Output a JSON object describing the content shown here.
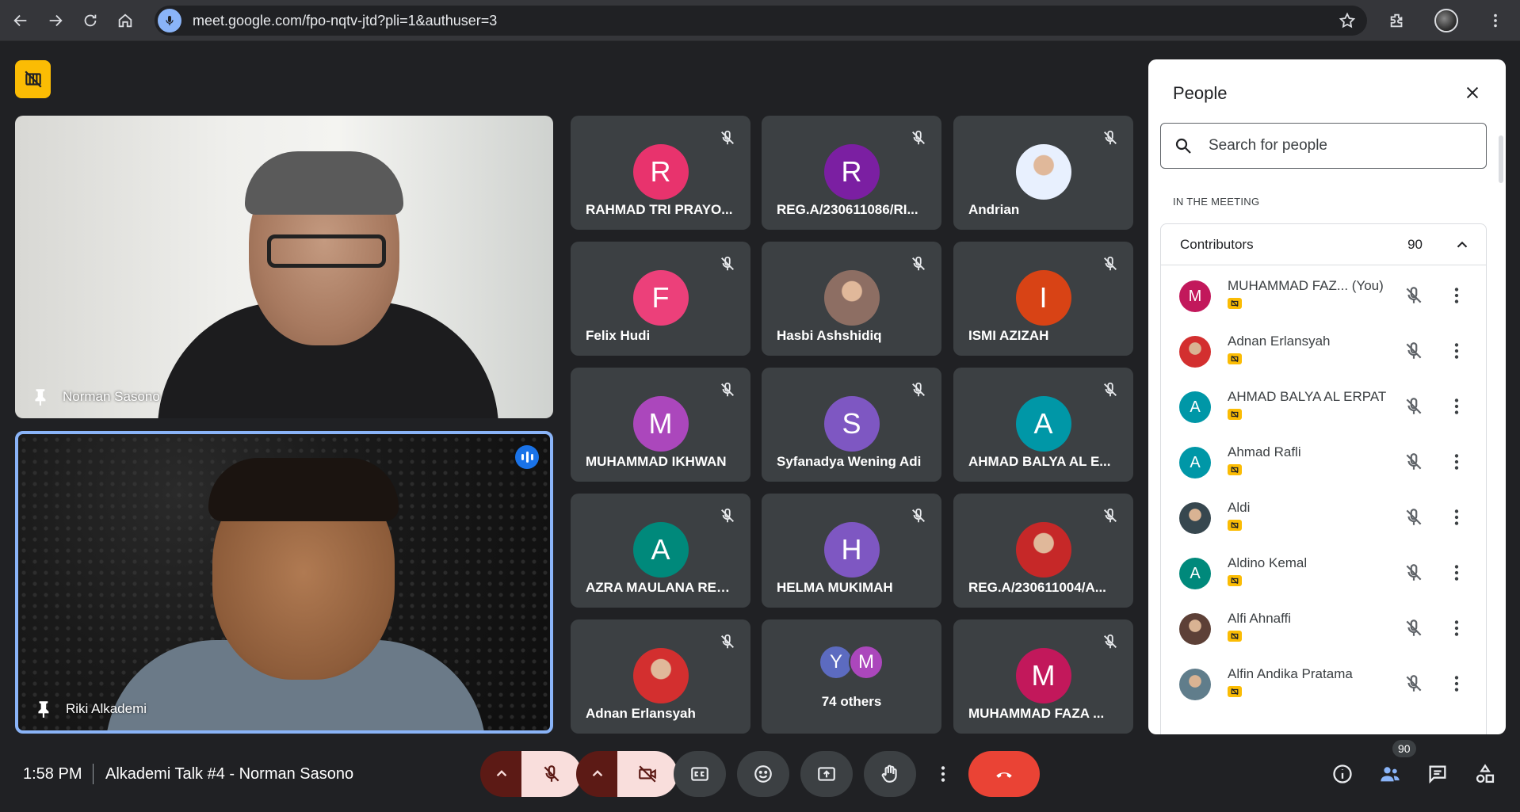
{
  "browser": {
    "url": "meet.google.com/fpo-nqtv-jtd?pli=1&authuser=3"
  },
  "videos": [
    {
      "name": "Norman Sasono"
    },
    {
      "name": "Riki Alkademi"
    }
  ],
  "grid": [
    {
      "name": "RAHMAD TRI PRAYO...",
      "initial": "R",
      "color": "#e8336d"
    },
    {
      "name": "REG.A/230611086/RI...",
      "initial": "R",
      "color": "#7b1fa2"
    },
    {
      "name": "Andrian",
      "initial": "",
      "color": "#e8f0fe"
    },
    {
      "name": "Felix Hudi",
      "initial": "F",
      "color": "#ec407a"
    },
    {
      "name": "Hasbi Ashshidiq",
      "initial": "",
      "color": "#8d6e63"
    },
    {
      "name": "ISMI AZIZAH",
      "initial": "I",
      "color": "#d84315"
    },
    {
      "name": "MUHAMMAD IKHWAN",
      "initial": "M",
      "color": "#ab47bc"
    },
    {
      "name": "Syfanadya Wening Adi",
      "initial": "S",
      "color": "#7e57c2"
    },
    {
      "name": "AHMAD BALYA AL E...",
      "initial": "A",
      "color": "#0097a7"
    },
    {
      "name": "AZRA MAULANA RES...",
      "initial": "A",
      "color": "#00897b"
    },
    {
      "name": "HELMA MUKIMAH",
      "initial": "H",
      "color": "#7e57c2"
    },
    {
      "name": "REG.A/230611004/A...",
      "initial": "",
      "color": "#c62828"
    },
    {
      "name": "Adnan Erlansyah",
      "initial": "",
      "color": "#d32f2f"
    },
    {
      "name": "MUHAMMAD FAZA ...",
      "initial": "M",
      "color": "#c2185b"
    }
  ],
  "others": {
    "label": "74 others",
    "initial_1": "Y",
    "initial_2": "M",
    "color_1": "#5c6bc0",
    "color_2": "#ab47bc"
  },
  "people_panel": {
    "title": "People",
    "search_placeholder": "Search for people",
    "section_label": "IN THE MEETING",
    "group_title": "Contributors",
    "group_count": "90",
    "participants": [
      {
        "name": "MUHAMMAD FAZ...  (You)",
        "initial": "M",
        "color": "#c2185b"
      },
      {
        "name": "Adnan Erlansyah",
        "initial": "",
        "color": "#d32f2f"
      },
      {
        "name": "AHMAD BALYA AL ERPAT",
        "initial": "A",
        "color": "#0097a7"
      },
      {
        "name": "Ahmad Rafli",
        "initial": "A",
        "color": "#0097a7"
      },
      {
        "name": "Aldi",
        "initial": "",
        "color": "#37474f"
      },
      {
        "name": "Aldino Kemal",
        "initial": "A",
        "color": "#00897b"
      },
      {
        "name": "Alfi Ahnaffi",
        "initial": "",
        "color": "#5d4037"
      },
      {
        "name": "Alfin Andika Pratama",
        "initial": "",
        "color": "#607d8b"
      }
    ]
  },
  "bottom_bar": {
    "time": "1:58 PM",
    "meeting_title": "Alkademi Talk #4 - Norman Sasono",
    "people_badge": "90"
  }
}
